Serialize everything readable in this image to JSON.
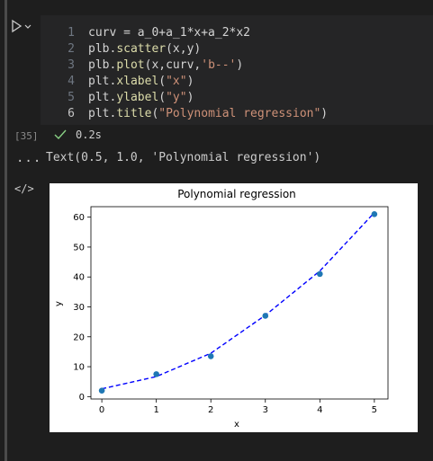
{
  "cell": {
    "code_lines": [
      {
        "n": "1",
        "tokens": [
          [
            "curv = a_0+a_1*x+a_2*x2",
            "tok-plain"
          ]
        ]
      },
      {
        "n": "2",
        "tokens": [
          [
            "plb.",
            "tok-plain"
          ],
          [
            "scatter",
            "tok-fn"
          ],
          [
            "(x,y)",
            "tok-plain"
          ]
        ]
      },
      {
        "n": "3",
        "tokens": [
          [
            "plb.",
            "tok-plain"
          ],
          [
            "plot",
            "tok-fn"
          ],
          [
            "(x,curv,",
            "tok-plain"
          ],
          [
            "'b--'",
            "tok-str"
          ],
          [
            ")",
            "tok-plain"
          ]
        ]
      },
      {
        "n": "4",
        "tokens": [
          [
            "plt.",
            "tok-plain"
          ],
          [
            "xlabel",
            "tok-fn"
          ],
          [
            "(",
            "tok-plain"
          ],
          [
            "\"x\"",
            "tok-str"
          ],
          [
            ")",
            "tok-plain"
          ]
        ]
      },
      {
        "n": "5",
        "tokens": [
          [
            "plt.",
            "tok-plain"
          ],
          [
            "ylabel",
            "tok-fn"
          ],
          [
            "(",
            "tok-plain"
          ],
          [
            "\"y\"",
            "tok-str"
          ],
          [
            ")",
            "tok-plain"
          ]
        ]
      },
      {
        "n": "6",
        "tokens": [
          [
            "plt.",
            "tok-plain"
          ],
          [
            "title",
            "tok-fn"
          ],
          [
            "(",
            "tok-plain"
          ],
          [
            "\"Polynomial regression\"",
            "tok-str"
          ],
          [
            ")",
            "tok-plain"
          ]
        ]
      }
    ],
    "execution_count": "[35]",
    "run_time": "0.2s",
    "status_color": "#89d185"
  },
  "output": {
    "ellipsis": "...",
    "text_result": "Text(0.5, 1.0, 'Polynomial regression')",
    "code_toggle": "</>"
  },
  "chart_data": {
    "type": "scatter",
    "title": "Polynomial regression",
    "xlabel": "x",
    "ylabel": "y",
    "xlim": [
      -0.2,
      5.25
    ],
    "ylim": [
      -0.8,
      63.5
    ],
    "xticks": [
      0,
      1,
      2,
      3,
      4,
      5
    ],
    "yticks": [
      0,
      10,
      20,
      30,
      40,
      50,
      60
    ],
    "scatter": {
      "x": [
        0,
        1,
        2,
        3,
        4,
        5
      ],
      "y": [
        2,
        7.5,
        13.5,
        27,
        41,
        61
      ],
      "color": "#1f77b4"
    },
    "curve": {
      "x": [
        0,
        1,
        2,
        3,
        4,
        5
      ],
      "y": [
        2.6,
        6.7,
        14.5,
        27.2,
        42.0,
        61.5
      ],
      "color": "#0000ff",
      "style": "b--"
    }
  }
}
